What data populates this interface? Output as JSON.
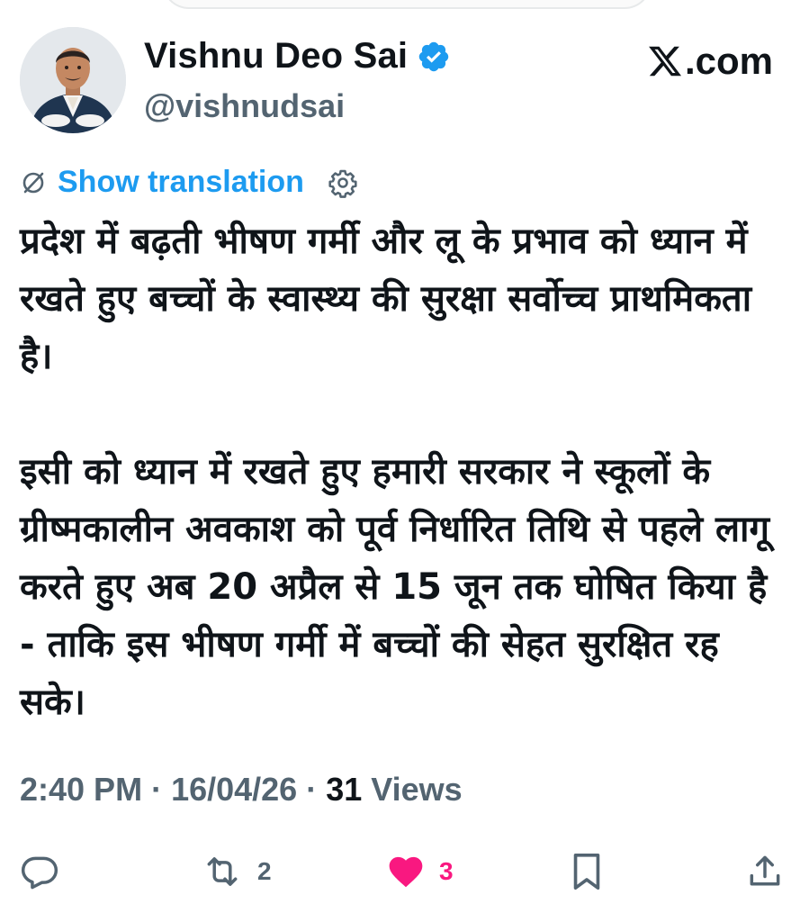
{
  "author": {
    "display_name": "Vishnu Deo Sai",
    "handle": "@vishnudsai",
    "verified": true,
    "verified_color": "#1d9bf0"
  },
  "brand": {
    "text": ".com"
  },
  "translation": {
    "label": "Show translation",
    "link_color": "#1d9bf0"
  },
  "tweet": {
    "paragraphs": [
      "प्रदेश में बढ़ती भीषण गर्मी और लू के प्रभाव को ध्यान में रखते हुए बच्चों के स्वास्थ्य की सुरक्षा सर्वोच्च प्राथमिकता है।",
      "इसी को ध्यान में रखते हुए हमारी सरकार ने स्कूलों के ग्रीष्मकालीन अवकाश को पूर्व निर्धारित तिथि से पहले लागू करते हुए अब 20 अप्रैल से 15 जून तक घोषित किया है - ताकि इस भीषण गर्मी में बच्चों की सेहत सुरक्षित रह सके।"
    ]
  },
  "meta": {
    "time": "2:40 PM",
    "separator": " · ",
    "date": "16/04/26",
    "views_count": "31",
    "views_label": " Views"
  },
  "actions": {
    "reply": {
      "icon": "reply-icon"
    },
    "repost": {
      "icon": "repost-icon",
      "count": "2"
    },
    "like": {
      "icon": "heart-icon",
      "count": "3",
      "liked": true,
      "color": "#f91880"
    },
    "bookmark": {
      "icon": "bookmark-icon"
    },
    "share": {
      "icon": "share-icon"
    }
  }
}
